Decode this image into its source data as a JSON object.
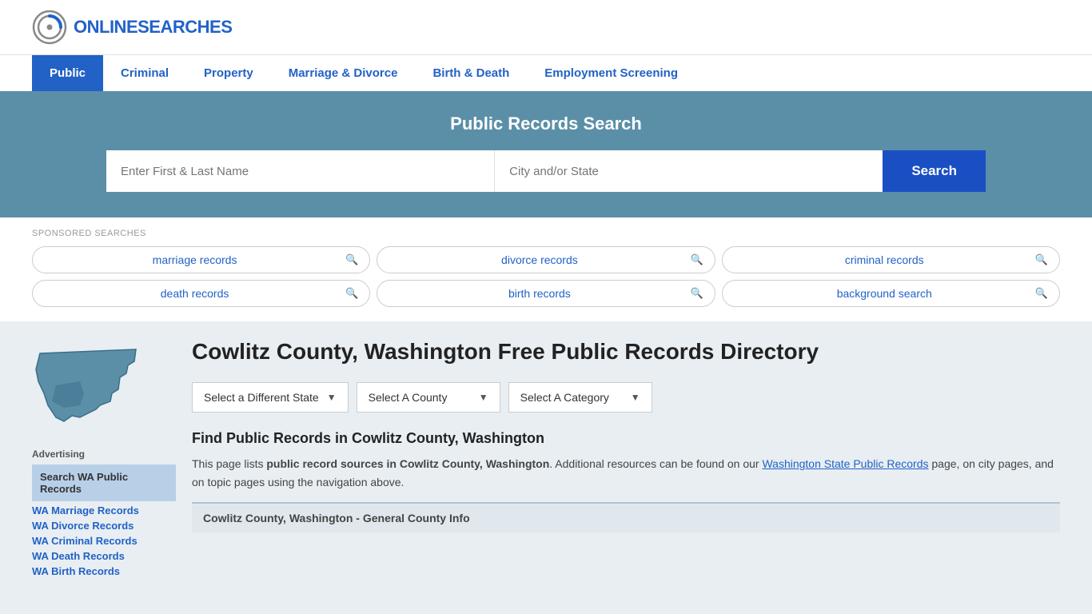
{
  "site": {
    "logo_text_normal": "ONLINE",
    "logo_text_accent": "SEARCHES"
  },
  "nav": {
    "items": [
      {
        "label": "Public",
        "active": true
      },
      {
        "label": "Criminal",
        "active": false
      },
      {
        "label": "Property",
        "active": false
      },
      {
        "label": "Marriage & Divorce",
        "active": false
      },
      {
        "label": "Birth & Death",
        "active": false
      },
      {
        "label": "Employment Screening",
        "active": false
      }
    ]
  },
  "hero": {
    "title": "Public Records Search",
    "name_placeholder": "Enter First & Last Name",
    "location_placeholder": "City and/or State",
    "search_button": "Search"
  },
  "sponsored": {
    "label": "SPONSORED SEARCHES",
    "items": [
      {
        "text": "marriage records"
      },
      {
        "text": "divorce records"
      },
      {
        "text": "criminal records"
      },
      {
        "text": "death records"
      },
      {
        "text": "birth records"
      },
      {
        "text": "background search"
      }
    ]
  },
  "page": {
    "title": "Cowlitz County, Washington Free Public Records Directory",
    "dropdowns": {
      "state": "Select a Different State",
      "county": "Select A County",
      "category": "Select A Category"
    },
    "find_title": "Find Public Records in Cowlitz County, Washington",
    "description_part1": "This page lists ",
    "description_bold": "public record sources in Cowlitz County, Washington",
    "description_part2": ". Additional resources can be found on our ",
    "description_link": "Washington State Public Records",
    "description_part3": " page, on city pages, and on topic pages using the navigation above.",
    "county_info_bar": "Cowlitz County, Washington - General County Info"
  },
  "sidebar": {
    "ad_label": "Advertising",
    "ad_item": "Search WA Public Records",
    "links": [
      "WA Marriage Records",
      "WA Divorce Records",
      "WA Criminal Records",
      "WA Death Records",
      "WA Birth Records"
    ]
  }
}
